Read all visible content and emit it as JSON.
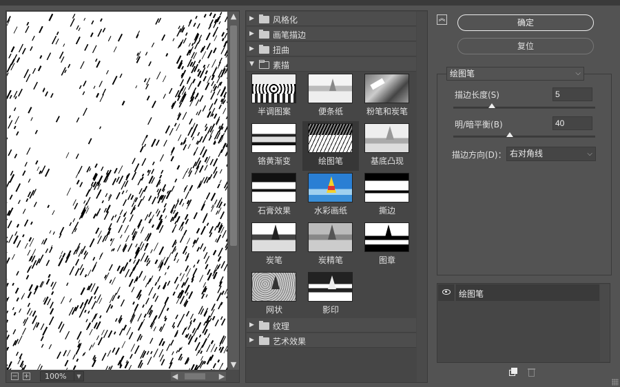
{
  "preview": {
    "zoom": "100%"
  },
  "gallery": {
    "categories_top": [
      {
        "label": "风格化",
        "expanded": false
      },
      {
        "label": "画笔描边",
        "expanded": false
      },
      {
        "label": "扭曲",
        "expanded": false
      },
      {
        "label": "素描",
        "expanded": true
      }
    ],
    "filters": [
      {
        "label": "半调图案"
      },
      {
        "label": "便条纸"
      },
      {
        "label": "粉笔和炭笔"
      },
      {
        "label": "铬黄渐变"
      },
      {
        "label": "绘图笔",
        "selected": true
      },
      {
        "label": "基底凸现"
      },
      {
        "label": "石膏效果"
      },
      {
        "label": "水彩画纸"
      },
      {
        "label": "撕边"
      },
      {
        "label": "炭笔"
      },
      {
        "label": "炭精笔"
      },
      {
        "label": "图章"
      },
      {
        "label": "网状"
      },
      {
        "label": "影印"
      }
    ],
    "categories_bottom": [
      {
        "label": "纹理",
        "expanded": false
      },
      {
        "label": "艺术效果",
        "expanded": false
      }
    ]
  },
  "actions": {
    "ok": "确定",
    "reset": "复位"
  },
  "settings": {
    "filter_name": "绘图笔",
    "stroke_length_label": "描边长度(S)",
    "stroke_length_value": "5",
    "stroke_length_fraction": 0.27,
    "balance_label": "明/暗平衡(B)",
    "balance_value": "40",
    "balance_fraction": 0.4,
    "direction_label": "描边方向(D)：",
    "direction_value": "右对角线"
  },
  "layers": {
    "items": [
      {
        "name": "绘图笔"
      }
    ]
  }
}
